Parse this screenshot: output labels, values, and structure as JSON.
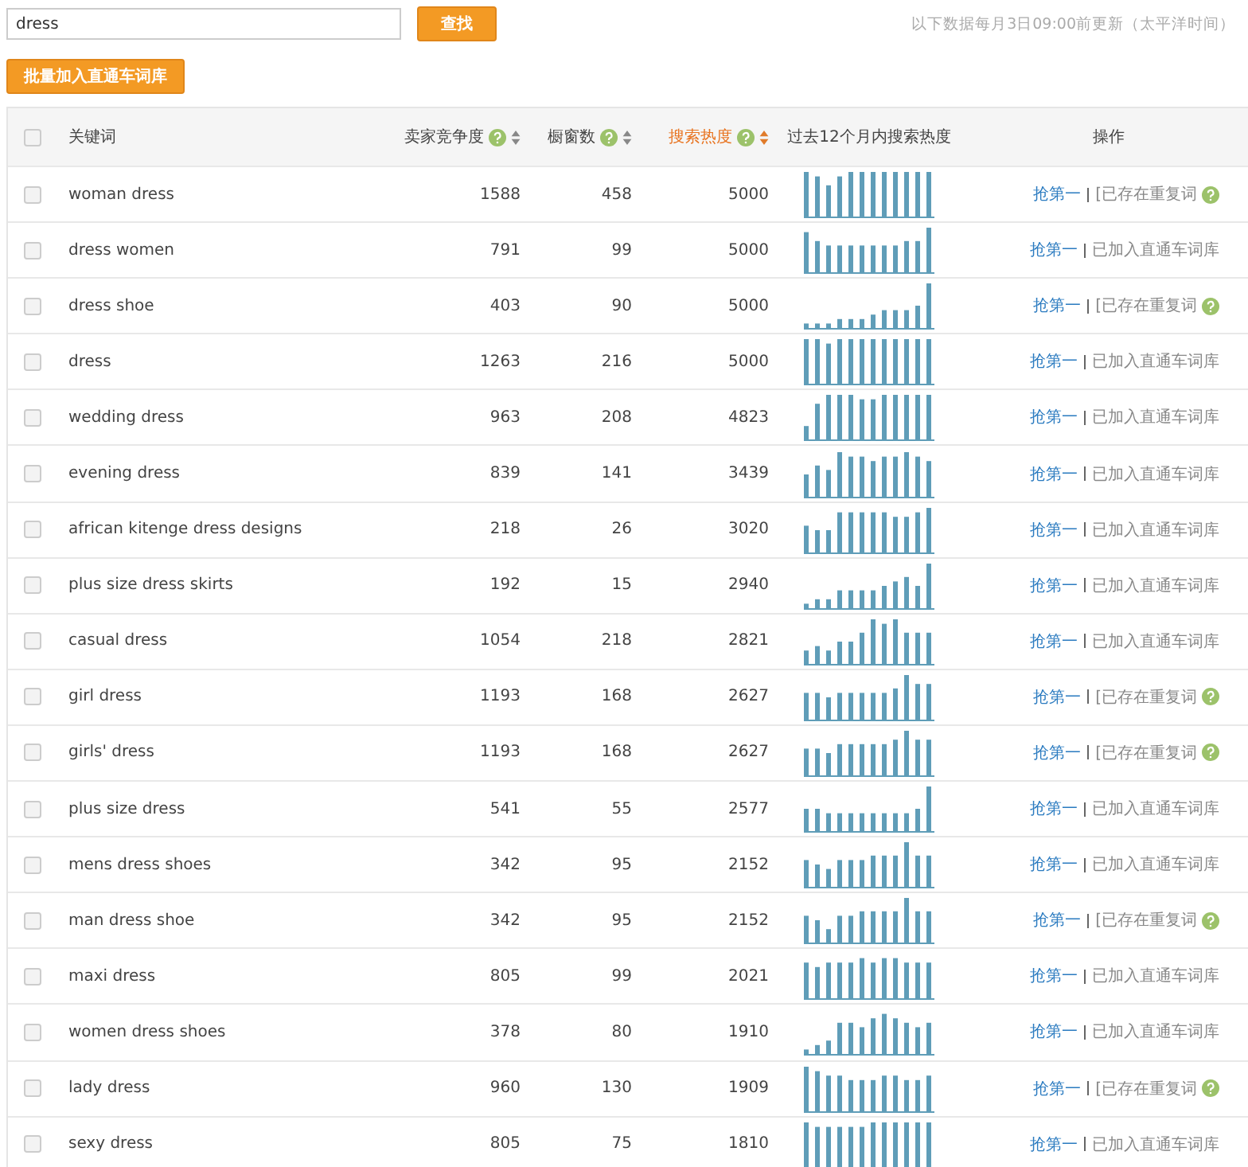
{
  "search": {
    "value": "dress",
    "button": "查找"
  },
  "update_note": "以下数据每月3日09:00前更新（太平洋时间）",
  "batch_button": "批量加入直通车词库",
  "table": {
    "select_all": {
      "checked": false
    },
    "columns": [
      {
        "label": "关键词",
        "help": false,
        "sortable": false,
        "selected": false
      },
      {
        "label": "卖家竞争度",
        "help": true,
        "sortable": true,
        "selected": false
      },
      {
        "label": "橱窗数",
        "help": true,
        "sortable": true,
        "selected": false
      },
      {
        "label": "搜索热度",
        "help": true,
        "sortable": true,
        "selected": true
      },
      {
        "label": "过去12个月内搜索热度",
        "help": false,
        "sortable": false,
        "selected": false
      },
      {
        "label": "操作",
        "help": false,
        "sortable": false,
        "selected": false
      }
    ],
    "rows": [
      {
        "keyword": "woman dress",
        "competition": "1588",
        "showcase": "458",
        "heat": "5000",
        "action": "抢第一",
        "kind": "duplicate",
        "status": "[已存在重复词",
        "checked": false
      },
      {
        "keyword": "dress women",
        "competition": "791",
        "showcase": "99",
        "heat": "5000",
        "action": "抢第一",
        "kind": "added",
        "status": "已加入直通车词库",
        "checked": false
      },
      {
        "keyword": "dress shoe",
        "competition": "403",
        "showcase": "90",
        "heat": "5000",
        "action": "抢第一",
        "kind": "duplicate",
        "status": "[已存在重复词",
        "checked": false
      },
      {
        "keyword": "dress",
        "competition": "1263",
        "showcase": "216",
        "heat": "5000",
        "action": "抢第一",
        "kind": "added",
        "status": "已加入直通车词库",
        "checked": false
      },
      {
        "keyword": "wedding dress",
        "competition": "963",
        "showcase": "208",
        "heat": "4823",
        "action": "抢第一",
        "kind": "added",
        "status": "已加入直通车词库",
        "checked": false
      },
      {
        "keyword": "evening dress",
        "competition": "839",
        "showcase": "141",
        "heat": "3439",
        "action": "抢第一",
        "kind": "added",
        "status": "已加入直通车词库",
        "checked": false
      },
      {
        "keyword": "african kitenge dress designs",
        "competition": "218",
        "showcase": "26",
        "heat": "3020",
        "action": "抢第一",
        "kind": "added",
        "status": "已加入直通车词库",
        "checked": false
      },
      {
        "keyword": "plus size dress skirts",
        "competition": "192",
        "showcase": "15",
        "heat": "2940",
        "action": "抢第一",
        "kind": "added",
        "status": "已加入直通车词库",
        "checked": false
      },
      {
        "keyword": "casual dress",
        "competition": "1054",
        "showcase": "218",
        "heat": "2821",
        "action": "抢第一",
        "kind": "added",
        "status": "已加入直通车词库",
        "checked": false
      },
      {
        "keyword": "girl dress",
        "competition": "1193",
        "showcase": "168",
        "heat": "2627",
        "action": "抢第一",
        "kind": "duplicate",
        "status": "[已存在重复词",
        "checked": false
      },
      {
        "keyword": "girls' dress",
        "competition": "1193",
        "showcase": "168",
        "heat": "2627",
        "action": "抢第一",
        "kind": "duplicate",
        "status": "[已存在重复词",
        "checked": false
      },
      {
        "keyword": "plus size dress",
        "competition": "541",
        "showcase": "55",
        "heat": "2577",
        "action": "抢第一",
        "kind": "added",
        "status": "已加入直通车词库",
        "checked": false
      },
      {
        "keyword": "mens dress shoes",
        "competition": "342",
        "showcase": "95",
        "heat": "2152",
        "action": "抢第一",
        "kind": "added",
        "status": "已加入直通车词库",
        "checked": false
      },
      {
        "keyword": "man dress shoe",
        "competition": "342",
        "showcase": "95",
        "heat": "2152",
        "action": "抢第一",
        "kind": "duplicate",
        "status": "[已存在重复词",
        "checked": false
      },
      {
        "keyword": "maxi dress",
        "competition": "805",
        "showcase": "99",
        "heat": "2021",
        "action": "抢第一",
        "kind": "added",
        "status": "已加入直通车词库",
        "checked": false
      },
      {
        "keyword": "women dress shoes",
        "competition": "378",
        "showcase": "80",
        "heat": "1910",
        "action": "抢第一",
        "kind": "added",
        "status": "已加入直通车词库",
        "checked": false
      },
      {
        "keyword": "lady dress",
        "competition": "960",
        "showcase": "130",
        "heat": "1909",
        "action": "抢第一",
        "kind": "duplicate",
        "status": "[已存在重复词",
        "checked": false
      },
      {
        "keyword": "sexy dress",
        "competition": "805",
        "showcase": "75",
        "heat": "1810",
        "action": "抢第一",
        "kind": "added",
        "status": "已加入直通车词库",
        "checked": false
      }
    ]
  }
}
